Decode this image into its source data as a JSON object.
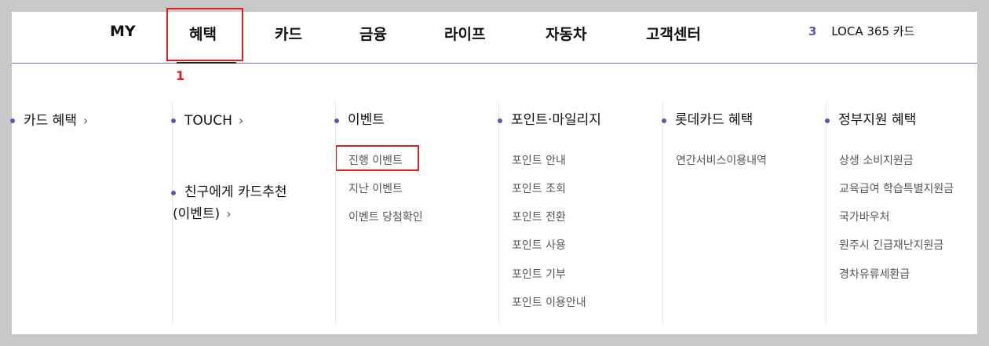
{
  "gnb": {
    "items": [
      "MY",
      "혜택",
      "카드",
      "금융",
      "라이프",
      "자동차",
      "고객센터"
    ],
    "active": "혜택"
  },
  "quick": {
    "count": "3",
    "label": "LOCA 365 카드"
  },
  "annotation": {
    "label": "1"
  },
  "columns": [
    {
      "categories": [
        {
          "label": "카드 혜택",
          "chevron": "›"
        }
      ],
      "items": []
    },
    {
      "categories": [
        {
          "label": "TOUCH",
          "chevron": "›"
        },
        {
          "label": "친구에게 카드추천",
          "label2": "(이벤트)",
          "chevron": "›"
        }
      ],
      "items": []
    },
    {
      "categories": [
        {
          "label": "이벤트"
        }
      ],
      "items": [
        "진행 이벤트",
        "지난 이벤트",
        "이벤트 당첨확인"
      ]
    },
    {
      "categories": [
        {
          "label": "포인트·마일리지"
        }
      ],
      "items": [
        "포인트 안내",
        "포인트 조회",
        "포인트 전환",
        "포인트 사용",
        "포인트 기부",
        "포인트 이용안내"
      ]
    },
    {
      "categories": [
        {
          "label": "롯데카드 혜택"
        }
      ],
      "items": [
        "연간서비스이용내역"
      ]
    },
    {
      "categories": [
        {
          "label": "정부지원 혜택"
        }
      ],
      "items": [
        "상생 소비지원금",
        "교육급여 학습특별지원금",
        "국가바우처",
        "원주시 긴급재난지원금",
        "경차유류세환급"
      ]
    }
  ],
  "colors": {
    "accent": "#6a4fb3",
    "highlight": "#e02020",
    "divider": "#e6e6e6"
  }
}
